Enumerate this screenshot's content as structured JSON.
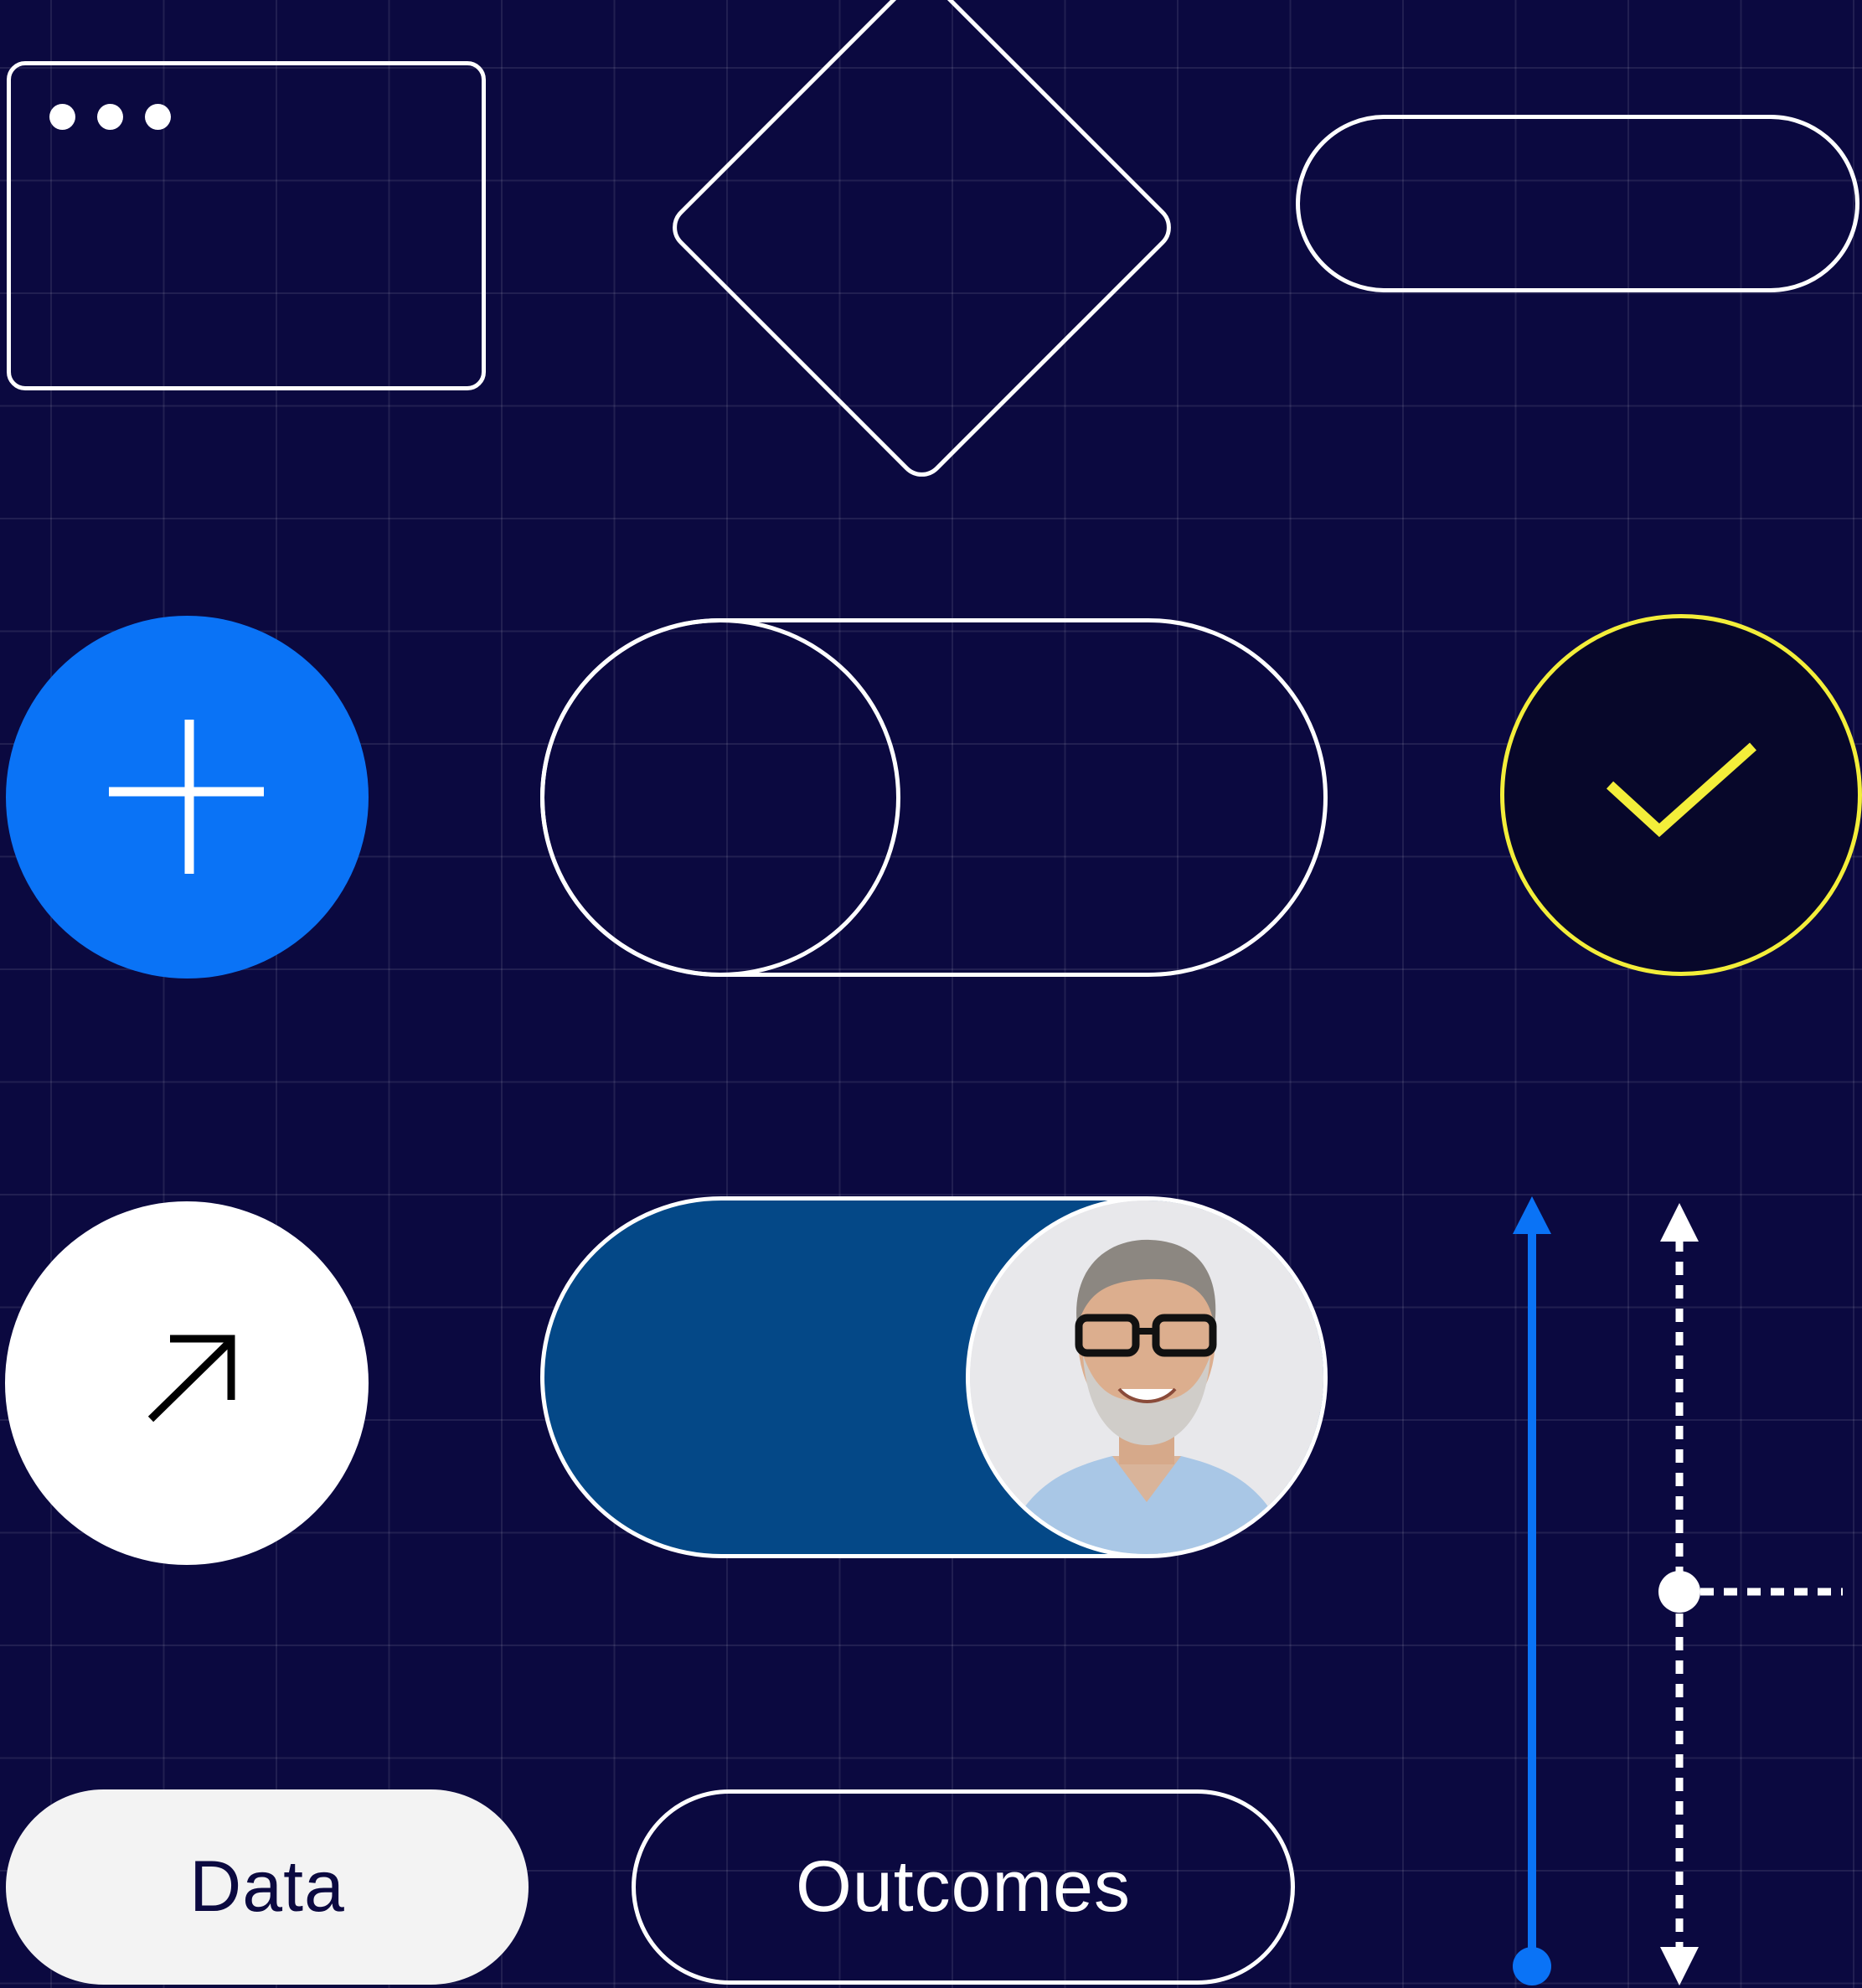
{
  "chips": {
    "data_label": "Data",
    "outcomes_label": "Outcomes"
  },
  "icons": {
    "window": "browser-window-icon",
    "diamond": "decision-diamond-shape",
    "pill": "terminator-pill-shape",
    "add": "plus-icon",
    "check": "checkmark-icon",
    "arrow": "arrow-up-right-icon",
    "avatar": "user-avatar-photo"
  },
  "toggles": {
    "plain_toggle_state": "off",
    "avatar_toggle_state": "on"
  },
  "colors": {
    "background": "#0b0940",
    "grid": "#2a2866",
    "accent_blue": "#0a73f6",
    "toggle_on_fill": "#044887",
    "check_yellow": "#f3ee3a",
    "white": "#ffffff",
    "chip_light": "#f3f3f3"
  }
}
